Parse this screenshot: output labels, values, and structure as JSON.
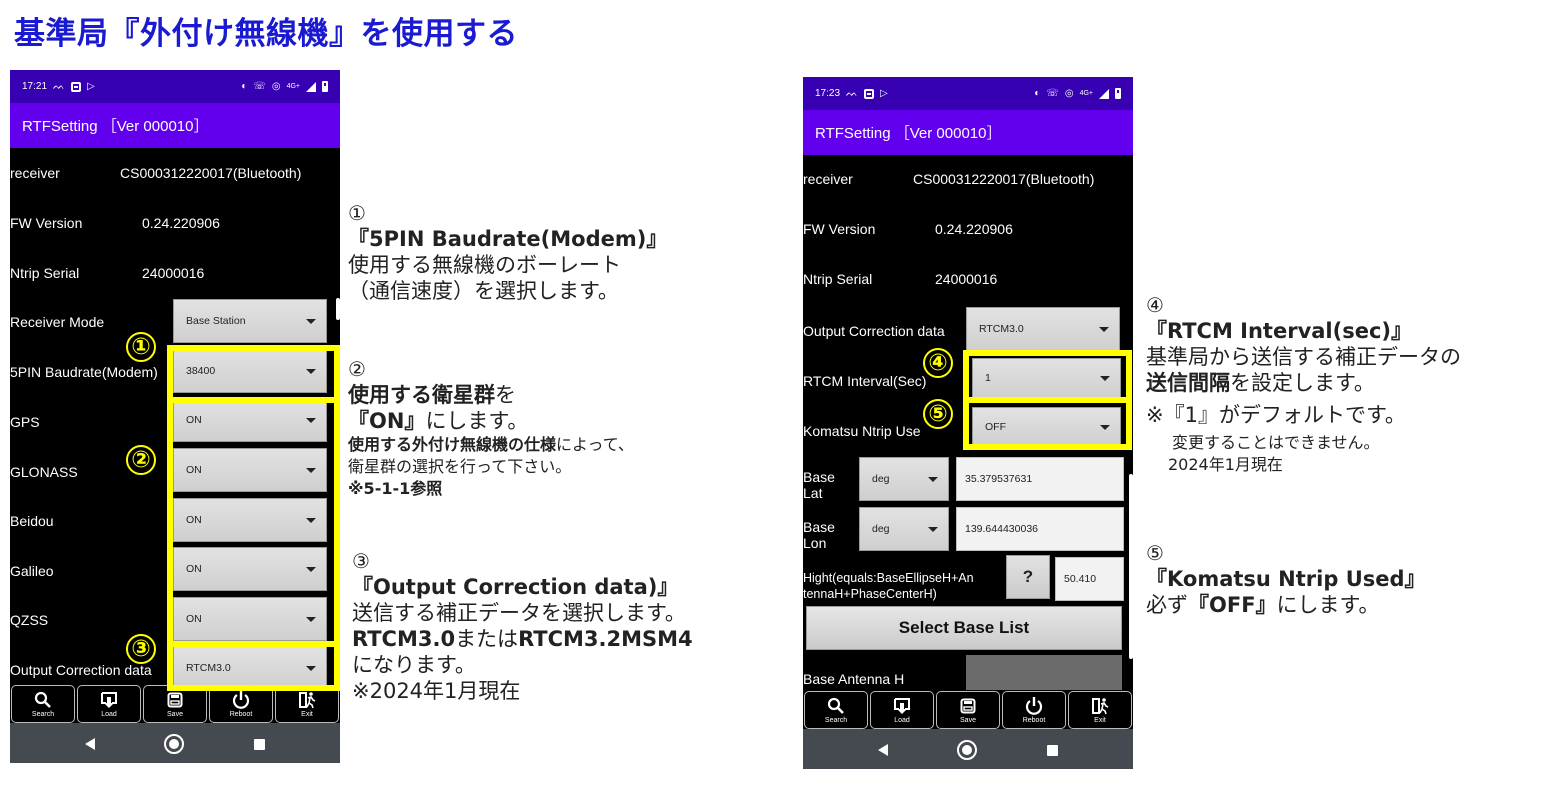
{
  "page": {
    "title": "基準局『外付け無線機』を使用する"
  },
  "colors": {
    "title": "#1a1ad0",
    "statusbar": "#3700b3",
    "appbar": "#6200ee",
    "highlight": "#ffff00",
    "navbar": "#444a4f"
  },
  "left_phone": {
    "status": {
      "time": "17:21",
      "net": "4G+"
    },
    "app_title": "RTFSetting ［Ver 000010］",
    "info": [
      {
        "label": "receiver",
        "value": "CS000312220017(Bluetooth)"
      },
      {
        "label": "FW Version",
        "value": "0.24.220906"
      },
      {
        "label": "Ntrip Serial",
        "value": "24000016"
      }
    ],
    "settings": [
      {
        "label": "Receiver Mode",
        "value": "Base Station"
      },
      {
        "label": "5PIN Baudrate(Modem)",
        "value": "38400"
      },
      {
        "label": "GPS",
        "value": "ON"
      },
      {
        "label": "GLONASS",
        "value": "ON"
      },
      {
        "label": "Beidou",
        "value": "ON"
      },
      {
        "label": "Galileo",
        "value": "ON"
      },
      {
        "label": "QZSS",
        "value": "ON"
      },
      {
        "label": "Output Correction data",
        "value": "RTCM3.0"
      }
    ],
    "badges": [
      "①",
      "②",
      "③"
    ]
  },
  "right_phone": {
    "status": {
      "time": "17:23",
      "net": "4G+"
    },
    "app_title": "RTFSetting ［Ver 000010］",
    "info": [
      {
        "label": "receiver",
        "value": "CS000312220017(Bluetooth)"
      },
      {
        "label": "FW Version",
        "value": "0.24.220906"
      },
      {
        "label": "Ntrip Serial",
        "value": "24000016"
      }
    ],
    "settings": [
      {
        "label": "Output Correction data",
        "value": "RTCM3.0"
      },
      {
        "label": "RTCM Interval(Sec)",
        "value": "1"
      },
      {
        "label": "Komatsu Ntrip Use",
        "value": "OFF"
      }
    ],
    "base_lat": {
      "label_1": "Base",
      "label_2": "Lat",
      "unit": "deg",
      "value": "35.379537631"
    },
    "base_lon": {
      "label_1": "Base",
      "label_2": "Lon",
      "unit": "deg",
      "value": "139.644430036"
    },
    "height": {
      "label_1": "Hight(equals:BaseEllipseH+An",
      "label_2": "tennaH+PhaseCenterH)",
      "help": "?",
      "value": "50.410"
    },
    "select_base_list": "Select Base List",
    "base_antenna_label": "Base Antenna H",
    "badges": [
      "④",
      "⑤"
    ]
  },
  "toolbar": [
    {
      "label": "Search",
      "icon": "search-icon"
    },
    {
      "label": "Load",
      "icon": "load-icon"
    },
    {
      "label": "Save",
      "icon": "save-icon"
    },
    {
      "label": "Reboot",
      "icon": "power-icon"
    },
    {
      "label": "Exit",
      "icon": "exit-icon"
    }
  ],
  "notes": {
    "n1": {
      "num": "①",
      "head": "『5PIN Baudrate(Modem)』",
      "lines": [
        "使用する無線機のボーレート",
        "（通信速度）を選択します。"
      ]
    },
    "n2": {
      "num": "②",
      "head_bold": "使用する衛星群",
      "head_tail": "を",
      "on_bold": "『ON』",
      "on_tail": "にします。",
      "spec_bold": "使用する外付け無線機の仕様",
      "spec_tail": "によって、",
      "line4": "衛星群の選択を行って下さい。",
      "ref": "※5-1-1参照"
    },
    "n3": {
      "num": "③",
      "head": "『Output Correction data)』",
      "line1": "送信する補正データを選択します。",
      "opt1": "RTCM3.0",
      "or": "または",
      "opt2": "RTCM3.2MSM4",
      "line3": "になります。",
      "line4": "※2024年1月現在"
    },
    "n4": {
      "num": "④",
      "head": "『RTCM Interval(sec)』",
      "line1": "基準局から送信する補正データの",
      "line2_bold": "送信間隔",
      "line2_tail": "を設定します。",
      "line3": "※『1』がデフォルトです。",
      "line4": "変更することはできません。",
      "line5": "2024年1月現在"
    },
    "n5": {
      "num": "⑤",
      "head": "『Komatsu Ntrip Used』",
      "pre": "必ず",
      "bold": "『OFF』",
      "tail": "にします。"
    }
  }
}
